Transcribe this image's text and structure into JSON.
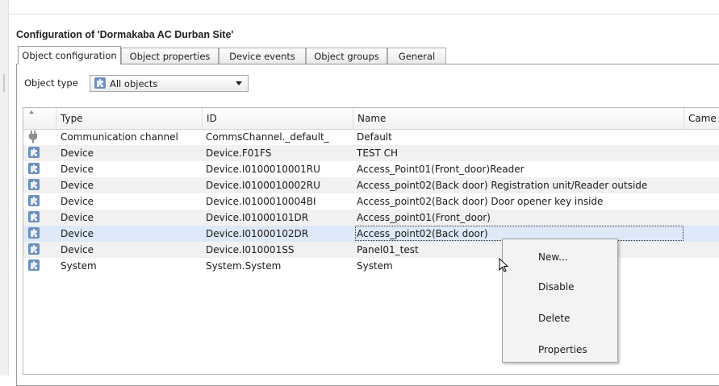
{
  "window": {
    "title": "Configuration of 'Dormakaba AC Durban Site'"
  },
  "tabs": [
    {
      "label": "Object configuration",
      "active": true
    },
    {
      "label": "Object properties",
      "active": false
    },
    {
      "label": "Device events",
      "active": false
    },
    {
      "label": "Object groups",
      "active": false
    },
    {
      "label": "General",
      "active": false
    }
  ],
  "filter": {
    "label": "Object type",
    "selected": "All objects",
    "icon": "puzzle-icon"
  },
  "table": {
    "columns": [
      "Type",
      "ID",
      "Name",
      "Came"
    ],
    "rows": [
      {
        "icon": "plug-icon",
        "type": "Communication channel",
        "id": "CommsChannel._default_",
        "name": "Default"
      },
      {
        "icon": "puzzle-icon",
        "type": "Device",
        "id": "Device.F01FS",
        "name": "TEST CH"
      },
      {
        "icon": "puzzle-icon",
        "type": "Device",
        "id": "Device.I0100010001RU",
        "name": "Access_Point01(Front_door)Reader"
      },
      {
        "icon": "puzzle-icon",
        "type": "Device",
        "id": "Device.I0100010002RU",
        "name": "Access_point02(Back door) Registration unit/Reader outside"
      },
      {
        "icon": "puzzle-icon",
        "type": "Device",
        "id": "Device.I0100010004BI",
        "name": "Access_point02(Back door) Door opener key inside"
      },
      {
        "icon": "puzzle-icon",
        "type": "Device",
        "id": "Device.I01000101DR",
        "name": "Access_point01(Front_door)"
      },
      {
        "icon": "puzzle-icon",
        "type": "Device",
        "id": "Device.I01000102DR",
        "name": "Access_point02(Back door)",
        "selected": true
      },
      {
        "icon": "puzzle-icon",
        "type": "Device",
        "id": "Device.I010001SS",
        "name": "Panel01_test"
      },
      {
        "icon": "puzzle-icon",
        "type": "System",
        "id": "System.System",
        "name": "System"
      }
    ]
  },
  "context_menu": {
    "items": [
      {
        "label": "New..."
      },
      {
        "label": "Disable"
      },
      {
        "label": "Delete"
      },
      {
        "label": "Properties"
      }
    ]
  },
  "colors": {
    "selection": "#dde8f8",
    "row_alt": "#f1f1f1",
    "border": "#9a9a9a"
  }
}
